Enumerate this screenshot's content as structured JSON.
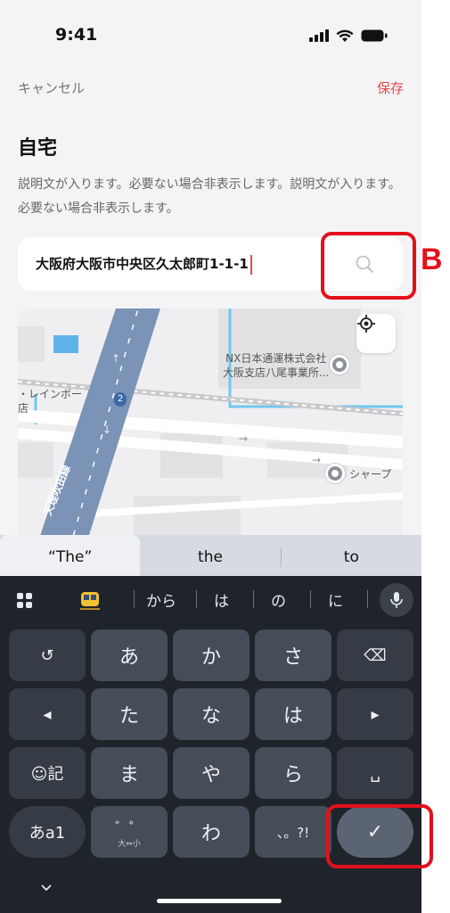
{
  "status": {
    "time": "9:41"
  },
  "nav": {
    "cancel": "キャンセル",
    "save": "保存"
  },
  "page": {
    "title": "自宅",
    "description": "説明文が入ります。必要ない場合非表示します。説明文が入ります。必要ない場合非表示します。"
  },
  "search": {
    "value": "大阪府大阪市中央区久太郎町1-1-1",
    "icon": "search-icon"
  },
  "annotation": {
    "b_label": "B"
  },
  "map": {
    "labels": {
      "poi1_line1": "NX日本通運株式会社",
      "poi1_line2": "大阪支店八尾事業所...",
      "rainbow": "・レインボー",
      "rainbow2": "店",
      "sharp": "シャープ",
      "road_badge": "2",
      "expressway": "天理吹田線"
    }
  },
  "suggestions": [
    "“The”",
    "the",
    "to"
  ],
  "keyboard": {
    "toolbar": [
      "から",
      "は",
      "の",
      "に"
    ],
    "rows": [
      [
        "↺",
        "あ",
        "か",
        "さ",
        "⌫"
      ],
      [
        "◂",
        "た",
        "な",
        "は",
        "▸"
      ],
      [
        "☺記",
        "ま",
        "や",
        "ら",
        "␣"
      ],
      [
        "あa1",
        "゛゜",
        "わ",
        "、。?!",
        "✓"
      ]
    ],
    "dakuten_sub": "大⇔小"
  },
  "colors": {
    "accent": "#e8494c",
    "annotation": "#e4101c",
    "keyboard_bg": "#1f242a"
  }
}
